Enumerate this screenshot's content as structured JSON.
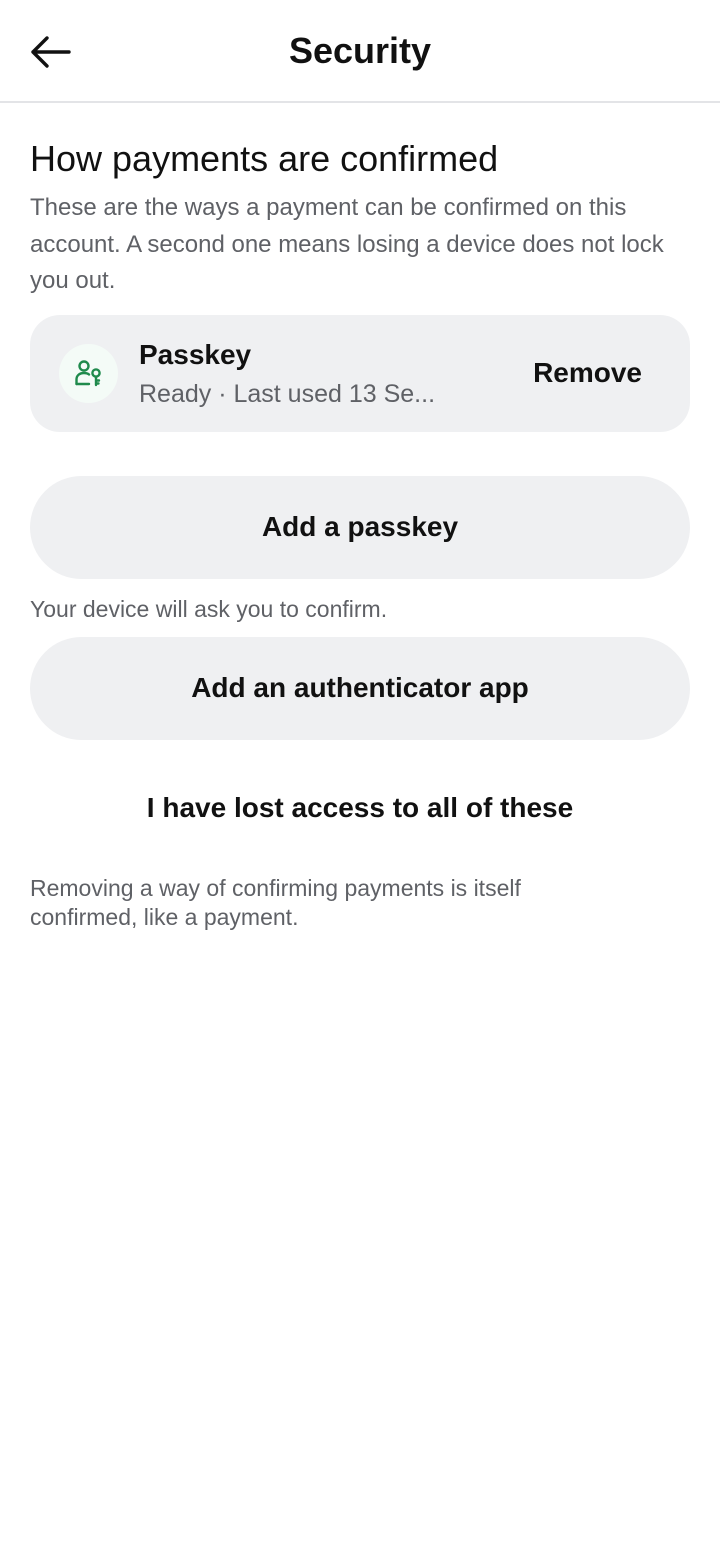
{
  "header": {
    "back_icon": "arrow-left-icon",
    "title": "Security"
  },
  "section": {
    "heading": "How payments are confirmed",
    "description": "These are the ways a payment can be confirmed on this account. A second one means losing a device does not lock you out."
  },
  "methods": [
    {
      "icon": "passkey-person-key-icon",
      "name": "Passkey",
      "status": "Ready · Last used 13 Se...",
      "remove_label": "Remove"
    }
  ],
  "actions": {
    "add_passkey_label": "Add a passkey",
    "add_passkey_hint": "Your device will ask you to confirm.",
    "add_authenticator_label": "Add an authenticator app",
    "lost_access_label": "I have lost access to all of these"
  },
  "footnote": "Removing a way of confirming payments is itself confirmed, like a payment.",
  "colors": {
    "accent_green": "#1f8a4c",
    "card_bg": "#eff0f2",
    "muted_text": "#5f6166"
  }
}
